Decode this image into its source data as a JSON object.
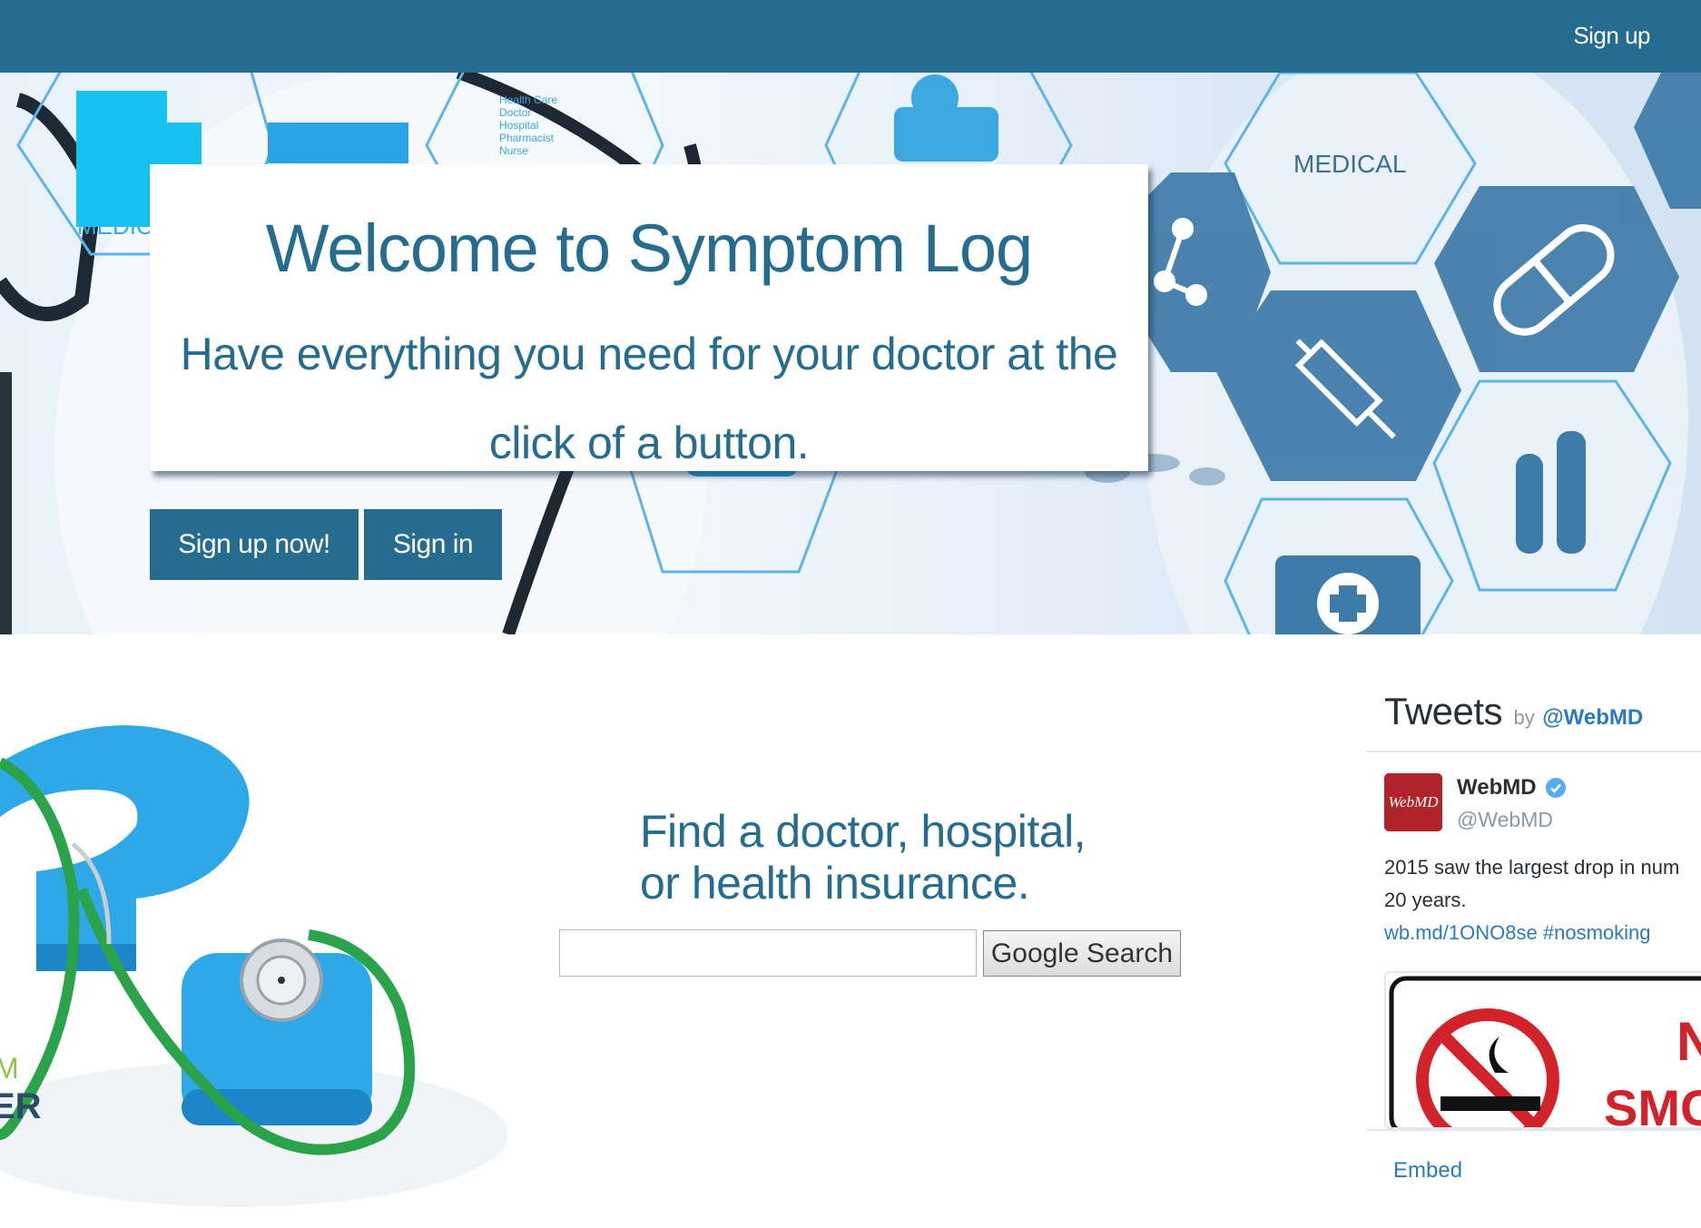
{
  "navbar": {
    "signup_label": "Sign up"
  },
  "hero": {
    "title": "Welcome to Symptom Log",
    "subtitle": "Have everything you need for your doctor at the click of a button.",
    "signup_now_label": "Sign up now!",
    "signin_label": "Sign in",
    "background_text": {
      "medical_right": "MEDICAL",
      "medical_left": "MEDIC",
      "list": [
        "Health Care",
        "Doctor",
        "Hospital",
        "Pharmacist",
        "Nurse"
      ]
    }
  },
  "search": {
    "heading_line1": "Find a doctor, hospital,",
    "heading_line2": "or health insurance.",
    "input_value": "",
    "button_label": "Google Search"
  },
  "left_illustration": {
    "text_top": "M",
    "text_bottom": "ER"
  },
  "tweets": {
    "title": "Tweets",
    "by": "by",
    "handle": "@WebMD",
    "tweet": {
      "avatar_text": "WebMD",
      "name": "WebMD",
      "screen_name": "@WebMD",
      "text_line1": "2015 saw the largest drop in num",
      "text_line2": "20 years.",
      "link": "wb.md/1ONO8se",
      "hashtag": "#nosmoking",
      "media_text_top": "N",
      "media_text_bottom": "SMC"
    },
    "embed_label": "Embed"
  },
  "colors": {
    "primary": "#266c8f",
    "twitter_link": "#2b7bb9",
    "accent_blue": "#3ba8e0",
    "green": "#2aa34a"
  }
}
